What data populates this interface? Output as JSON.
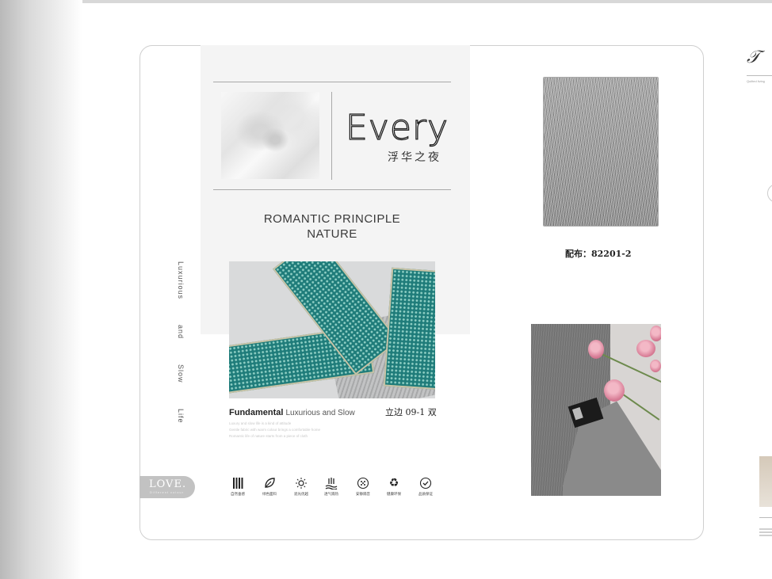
{
  "brochure": {
    "headline": "Every",
    "headline_cn": "浮华之夜",
    "tagline_line1": "ROMANTIC PRINCIPLE",
    "tagline_line2": "NATURE",
    "side_words": [
      "Luxurious",
      "and",
      "Slow",
      "Life"
    ],
    "fundamental_bold": "Fundamental",
    "fundamental_light": "Luxurious and Slow",
    "fundamental_code": "立边 09-1 双",
    "fine_print": [
      "Luxury and slow life is a kind of attitude",
      "Gentle fabric with warm colour brings a comfortable home",
      "Romantic life of nature starts from a piece of cloth"
    ],
    "love_badge": "LOVE.",
    "love_badge_small": "Different colour",
    "fabric_code": "配布：82201-2",
    "features": [
      {
        "icon": "vertical-bars-icon",
        "label": "自然垂感"
      },
      {
        "icon": "leaf-icon",
        "label": "绿色面料"
      },
      {
        "icon": "sun-icon",
        "label": "遮光优越"
      },
      {
        "icon": "airflow-icon",
        "label": "透气隔热"
      },
      {
        "icon": "sound-dots-icon",
        "label": "安静隔音"
      },
      {
        "icon": "recycle-icon",
        "label": "健康环保"
      },
      {
        "icon": "check-shield-icon",
        "label": "品质保证"
      }
    ]
  },
  "next_page": {
    "logo_glyph": "𝒯",
    "subtitle": "Quilted living"
  }
}
